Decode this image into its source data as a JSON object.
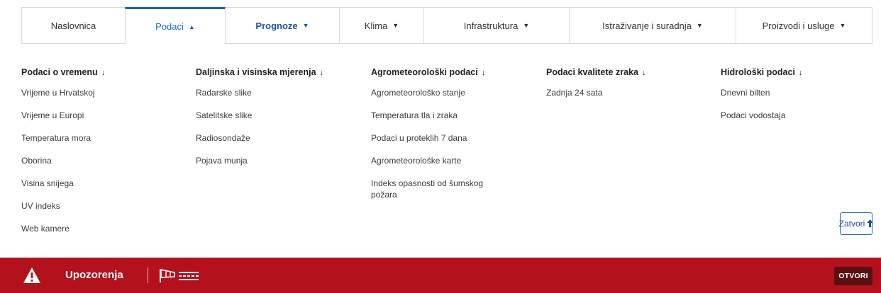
{
  "nav": {
    "tabs": [
      {
        "label": "Naslovnica",
        "caret": ""
      },
      {
        "label": "Podaci",
        "caret": "▲"
      },
      {
        "label": "Prognoze",
        "caret": "▼"
      },
      {
        "label": "Klima",
        "caret": "▼"
      },
      {
        "label": "Infrastruktura",
        "caret": "▼"
      },
      {
        "label": "Istraživanje i suradnja",
        "caret": "▼"
      },
      {
        "label": "Proizvodi i usluge",
        "caret": "▼"
      }
    ]
  },
  "menu": {
    "columns": [
      {
        "heading": "Podaci o vremenu",
        "items": [
          "Vrijeme u Hrvatskoj",
          "Vrijeme u Europi",
          "Temperatura mora",
          "Oborina",
          "Visina snijega",
          "UV indeks",
          "Web kamere"
        ]
      },
      {
        "heading": "Daljinska i visinska mjerenja",
        "items": [
          "Radarske slike",
          "Satelitske slike",
          "Radiosondaže",
          "Pojava munja"
        ]
      },
      {
        "heading": "Agrometeorološki podaci",
        "items": [
          "Agrometeorološko stanje",
          "Temperatura tla i zraka",
          "Podaci u proteklih 7 dana",
          "Agrometeorološke karte",
          "Indeks opasnosti od šumskog požara"
        ]
      },
      {
        "heading": "Podaci kvalitete zraka",
        "items": [
          "Zadnja 24 sata"
        ]
      },
      {
        "heading": "Hidrološki podaci",
        "items": [
          "Dnevni bilten",
          "Podaci vodostaja"
        ]
      }
    ],
    "heading_arrow": "↓",
    "close_label": "Zatvori",
    "close_arrow": "🡑"
  },
  "warnings": {
    "title": "Upozorenja",
    "open_label": "OTVORI",
    "icons": [
      "warning-triangle-icon",
      "windsock-icon",
      "wind-lines-icon"
    ],
    "bar_color": "#b3121d"
  }
}
